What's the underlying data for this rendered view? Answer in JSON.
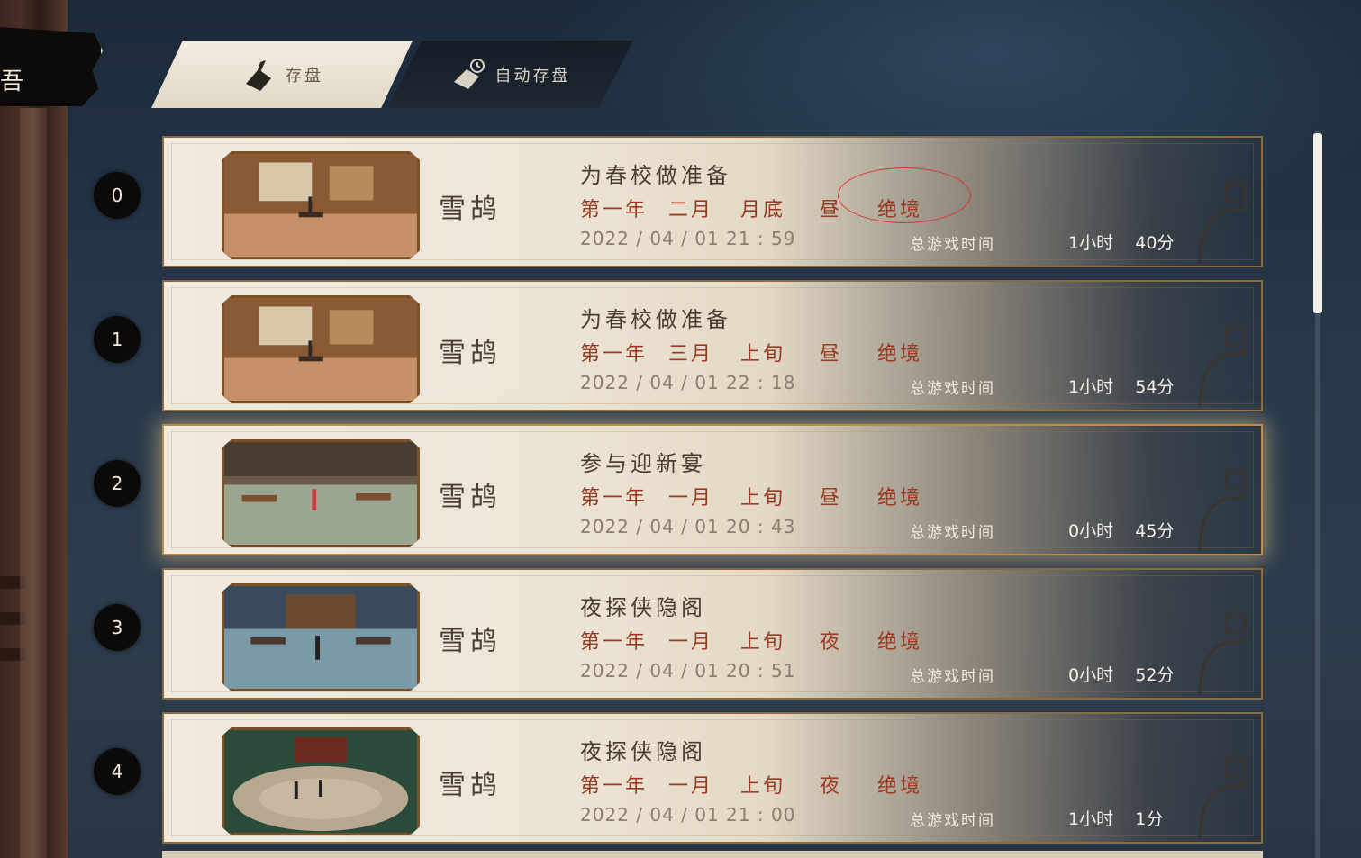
{
  "back": {
    "glyph": "吾"
  },
  "tabs": [
    {
      "label": "存盘",
      "icon": "book-quill-icon",
      "active": true
    },
    {
      "label": "自动存盘",
      "icon": "book-clock-icon",
      "active": false
    }
  ],
  "playtime_label": "总游戏时间",
  "slots": [
    {
      "number": "0",
      "name": "雪鸪",
      "quest": "为春校做准备",
      "year": "第一年",
      "month": "二月",
      "period": "月底",
      "time_of_day": "昼",
      "difficulty": "绝境",
      "real_date": "2022 / 04 / 01   21 : 59",
      "hours": "1小时",
      "minutes": "40分",
      "scene": "indoor"
    },
    {
      "number": "1",
      "name": "雪鸪",
      "quest": "为春校做准备",
      "year": "第一年",
      "month": "三月",
      "period": "上旬",
      "time_of_day": "昼",
      "difficulty": "绝境",
      "real_date": "2022 / 04 / 01   22 : 18",
      "hours": "1小时",
      "minutes": "54分",
      "scene": "indoor"
    },
    {
      "number": "2",
      "name": "雪鸪",
      "quest": "参与迎新宴",
      "year": "第一年",
      "month": "一月",
      "period": "上旬",
      "time_of_day": "昼",
      "difficulty": "绝境",
      "real_date": "2022 / 04 / 01   20 : 43",
      "hours": "0小时",
      "minutes": "45分",
      "scene": "courtyard"
    },
    {
      "number": "3",
      "name": "雪鸪",
      "quest": "夜探侠隐阁",
      "year": "第一年",
      "month": "一月",
      "period": "上旬",
      "time_of_day": "夜",
      "difficulty": "绝境",
      "real_date": "2022 / 04 / 01   20 : 51",
      "hours": "0小时",
      "minutes": "52分",
      "scene": "night-yard"
    },
    {
      "number": "4",
      "name": "雪鸪",
      "quest": "夜探侠隐阁",
      "year": "第一年",
      "month": "一月",
      "period": "上旬",
      "time_of_day": "夜",
      "difficulty": "绝境",
      "real_date": "2022 / 04 / 01   21 : 00",
      "hours": "1小时",
      "minutes": "1分",
      "scene": "arena"
    }
  ],
  "colors": {
    "card_bg": "#f1ebdf",
    "game_date": "#9a3b22",
    "frame": "#7a5228",
    "annotation": "#dd3333"
  }
}
